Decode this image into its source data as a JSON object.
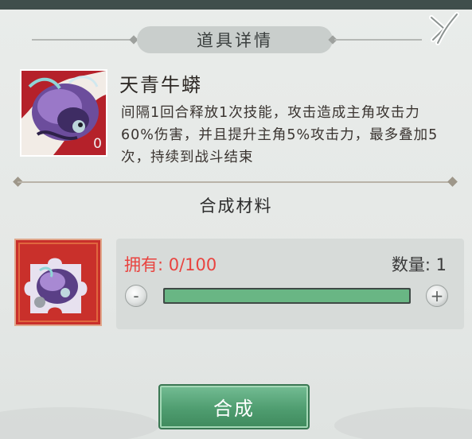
{
  "dialog": {
    "title": "道具详情"
  },
  "item": {
    "name": "天青牛蟒",
    "count": "0",
    "description": "间隔1回合释放1次技能，攻击造成主角攻击力60%伤害，并且提升主角5%攻击力，最多叠加5次，持续到战斗结束"
  },
  "materials": {
    "section_title": "合成材料",
    "owned_label": "拥有: 0/100",
    "quantity_label": "数量: 1",
    "progress": 1.0,
    "minus": "-",
    "plus": "+"
  },
  "craft_button": "合成",
  "colors": {
    "owned_text": "#e9433f",
    "progress_fill": "#69b684",
    "craft_button": "#4f9d70"
  },
  "icons": {
    "close": "close-x-icon",
    "item": "serpent-creature-icon",
    "material": "puzzle-fragment-icon"
  }
}
